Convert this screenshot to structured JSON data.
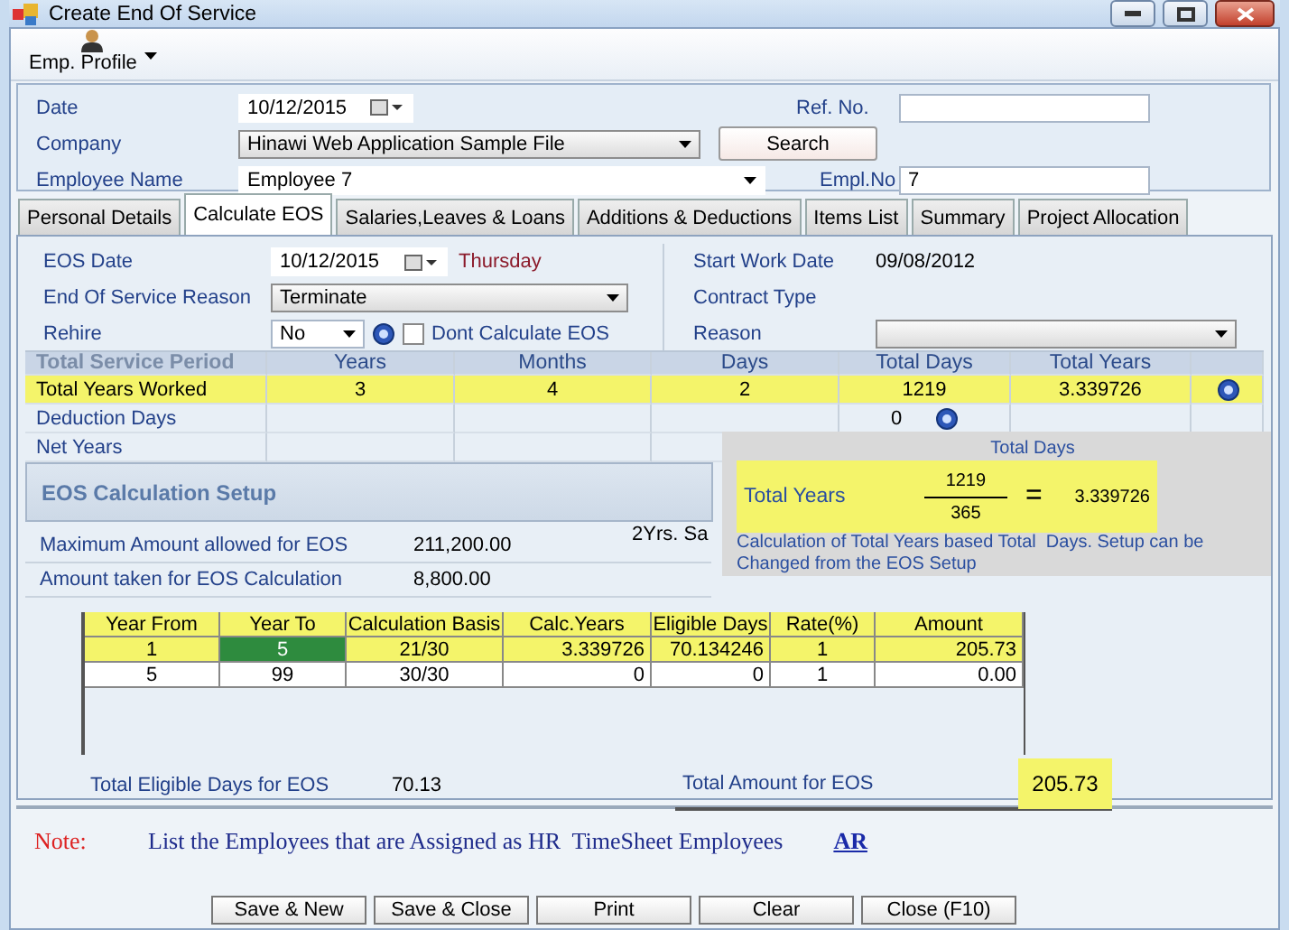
{
  "window": {
    "title": "Create End Of Service"
  },
  "toolbar": {
    "items": [
      {
        "label": "Emp. Profile"
      }
    ]
  },
  "header": {
    "date": {
      "label": "Date",
      "value": "10/12/2015"
    },
    "company": {
      "label": "Company",
      "value": "Hinawi Web Application Sample File"
    },
    "search_button": "Search",
    "employee_name": {
      "label": "Employee Name",
      "value": "Employee 7"
    },
    "ref_no": {
      "label": "Ref. No."
    },
    "empl_no": {
      "label": "Empl.No",
      "value": "7"
    }
  },
  "tabs": [
    {
      "label": "Personal Details",
      "selected": false
    },
    {
      "label": "Calculate EOS",
      "selected": true
    },
    {
      "label": "Salaries,Leaves & Loans",
      "selected": false
    },
    {
      "label": "Additions & Deductions",
      "selected": false
    },
    {
      "label": "Items List",
      "selected": false
    },
    {
      "label": "Summary",
      "selected": false
    },
    {
      "label": "Project Allocation",
      "selected": false
    }
  ],
  "eos": {
    "eos_date": {
      "label": "EOS Date",
      "value": "10/12/2015",
      "weekday": "Thursday"
    },
    "start_work_date": {
      "label": "Start Work Date",
      "value": "09/08/2012"
    },
    "reason": {
      "label": "End Of Service Reason",
      "value": "Terminate"
    },
    "contract_type": {
      "label": "Contract Type"
    },
    "rehire": {
      "label": "Rehire",
      "value": "No"
    },
    "dont_calculate": {
      "label": "Dont Calculate EOS",
      "checked": false
    },
    "reason2": {
      "label": "Reason"
    }
  },
  "service_period": {
    "columns": [
      "Total Service Period",
      "Years",
      "Months",
      "Days",
      "Total Days",
      "Total Years"
    ],
    "rows": [
      {
        "label": "Total Years Worked",
        "years": "3",
        "months": "4",
        "days": "2",
        "total_days": "1219",
        "total_years": "3.339726",
        "highlighted": true,
        "help_at_row_end": true
      },
      {
        "label": "Deduction Days",
        "total_days": "0",
        "highlighted": false,
        "help_after_total_days": true
      },
      {
        "label": "Net Years",
        "highlighted": false
      }
    ]
  },
  "setup": {
    "title": "EOS Calculation Setup",
    "fields": [
      {
        "label": "Maximum Amount allowed for EOS",
        "value": "211,200.00"
      },
      {
        "label": "Amount taken for EOS Calculation",
        "value": "8,800.00"
      }
    ],
    "side_text": "2Yrs. Sa"
  },
  "tooltip": {
    "header": "Total Days",
    "label": "Total Years",
    "numerator": "1219",
    "denominator": "365",
    "equals": "=",
    "result": "3.339726",
    "note": "Calculation of Total Years based Total  Days. Setup can be Changed from the EOS Setup",
    "highlighted": true
  },
  "calc_table": {
    "columns": [
      "Year From",
      "Year To",
      "Calculation Basis",
      "Calc.Years",
      "Eligible Days",
      "Rate(%)",
      "Amount"
    ],
    "header_highlighted": true,
    "rows": [
      {
        "highlighted": true,
        "cells": [
          {
            "text": "1",
            "selected": false
          },
          {
            "text": "5",
            "selected": true
          },
          {
            "text": "21/30",
            "selected": false
          },
          {
            "text": "3.339726",
            "selected": false
          },
          {
            "text": "70.134246",
            "selected": false
          },
          {
            "text": "1",
            "selected": false
          },
          {
            "text": "205.73",
            "selected": false
          }
        ]
      },
      {
        "highlighted": false,
        "cells": [
          {
            "text": "5",
            "selected": false
          },
          {
            "text": "99",
            "selected": false
          },
          {
            "text": "30/30",
            "selected": false
          },
          {
            "text": "0",
            "selected": false
          },
          {
            "text": "0",
            "selected": false
          },
          {
            "text": "1",
            "selected": false
          },
          {
            "text": "0.00",
            "selected": false
          }
        ]
      }
    ]
  },
  "totals": [
    {
      "label": "Total Eligible Days for EOS",
      "value": "70.13",
      "highlighted": false
    },
    {
      "label": "Total Amount for EOS",
      "value": "205.73",
      "highlighted": true
    }
  ],
  "note": {
    "label": "Note:",
    "text": "List the Employees that are Assigned as HR  TimeSheet Employees",
    "link": "AR"
  },
  "buttons": [
    "Save & New",
    "Save & Close",
    "Print",
    "Clear",
    "Close (F10)"
  ]
}
